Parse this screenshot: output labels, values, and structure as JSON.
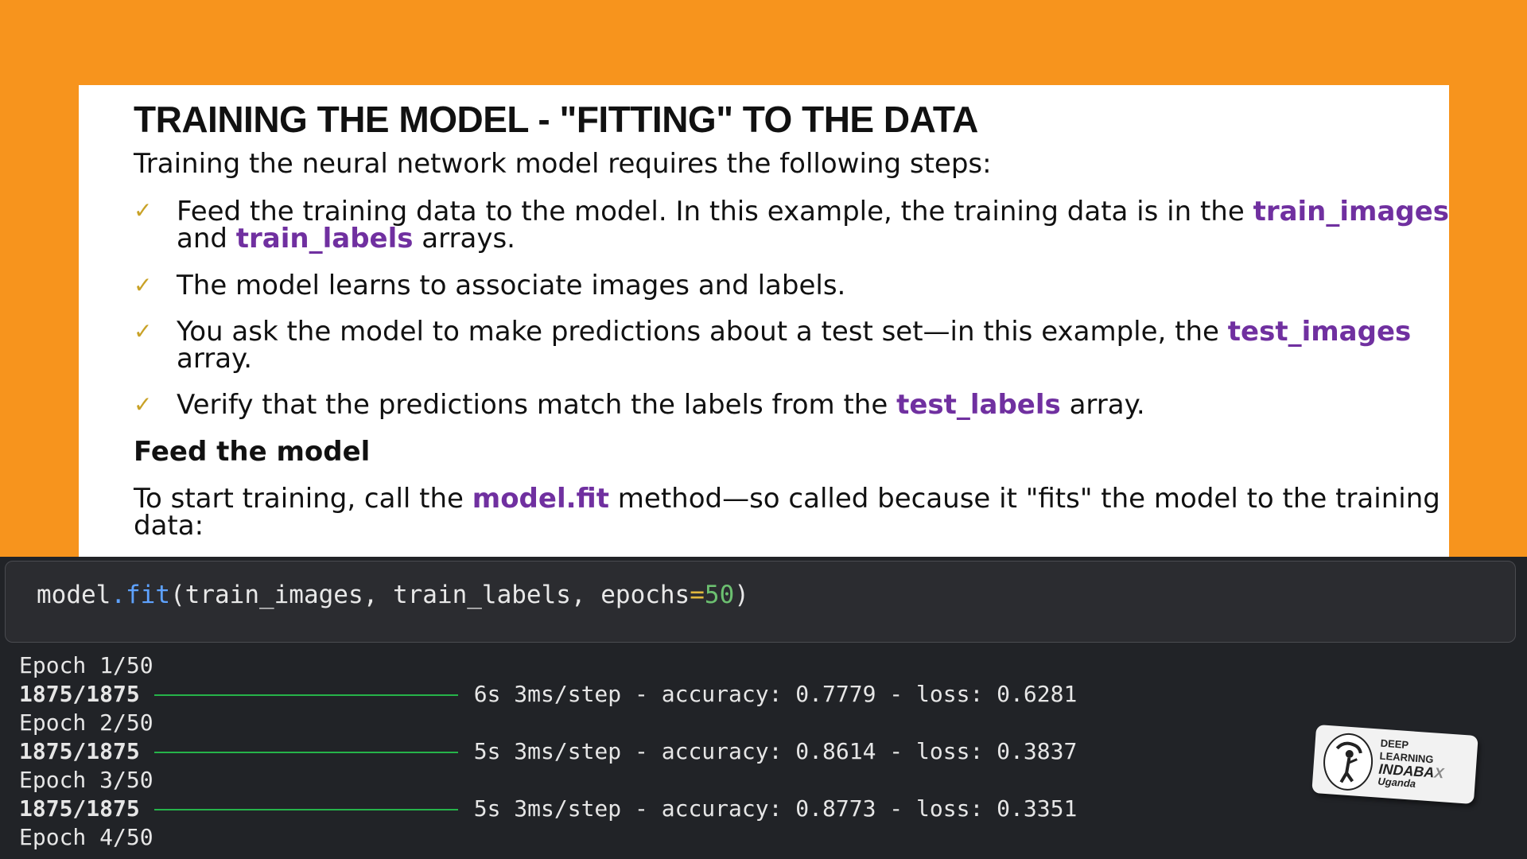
{
  "slide": {
    "title": "TRAINING THE MODEL - \"FITTING\" TO THE DATA",
    "intro": "Training the neural network model requires the following steps:",
    "bullets": [
      {
        "a": "Feed the training data to the model. In this example, the training data is in the ",
        "h1": "train_images",
        "b": "and ",
        "h2": "train_labels",
        "c": " arrays."
      },
      {
        "a": "The model learns to associate images and labels."
      },
      {
        "a": "You ask the model to make predictions about a test set—in this example, the ",
        "h1": "test_images",
        "b": "array."
      },
      {
        "a": "Verify that the predictions match the labels from the ",
        "h1": "test_labels",
        "b": " array."
      }
    ],
    "subheading": "Feed the model",
    "fit_text": {
      "a": "To start training, call the ",
      "h": "model.fit",
      "b": " method—so called because it \"fits\" the model to the training",
      "c": "data:"
    }
  },
  "code": {
    "obj": "model",
    "dot": ".",
    "fn": "fit",
    "args": "(train_images, train_labels, epochs",
    "eq": "=",
    "num": "50",
    "close": ")"
  },
  "output": [
    {
      "epoch": "Epoch 1/50",
      "steps": "1875/1875",
      "stats": "6s 3ms/step - accuracy: 0.7779 - loss: 0.6281"
    },
    {
      "epoch": "Epoch 2/50",
      "steps": "1875/1875",
      "stats": "5s 3ms/step - accuracy: 0.8614 - loss: 0.3837"
    },
    {
      "epoch": "Epoch 3/50",
      "steps": "1875/1875",
      "stats": "5s 3ms/step - accuracy: 0.8773 - loss: 0.3351"
    },
    {
      "epoch": "Epoch 4/50"
    }
  ],
  "logo": {
    "line1": "DEEP",
    "line2": "LEARNING",
    "line3": "INDABA",
    "mark": "X",
    "line4": "Uganda"
  },
  "colors": {
    "background": "#f7941d",
    "highlight": "#7030a0",
    "terminal": "#212327",
    "progress": "#26b34a"
  }
}
